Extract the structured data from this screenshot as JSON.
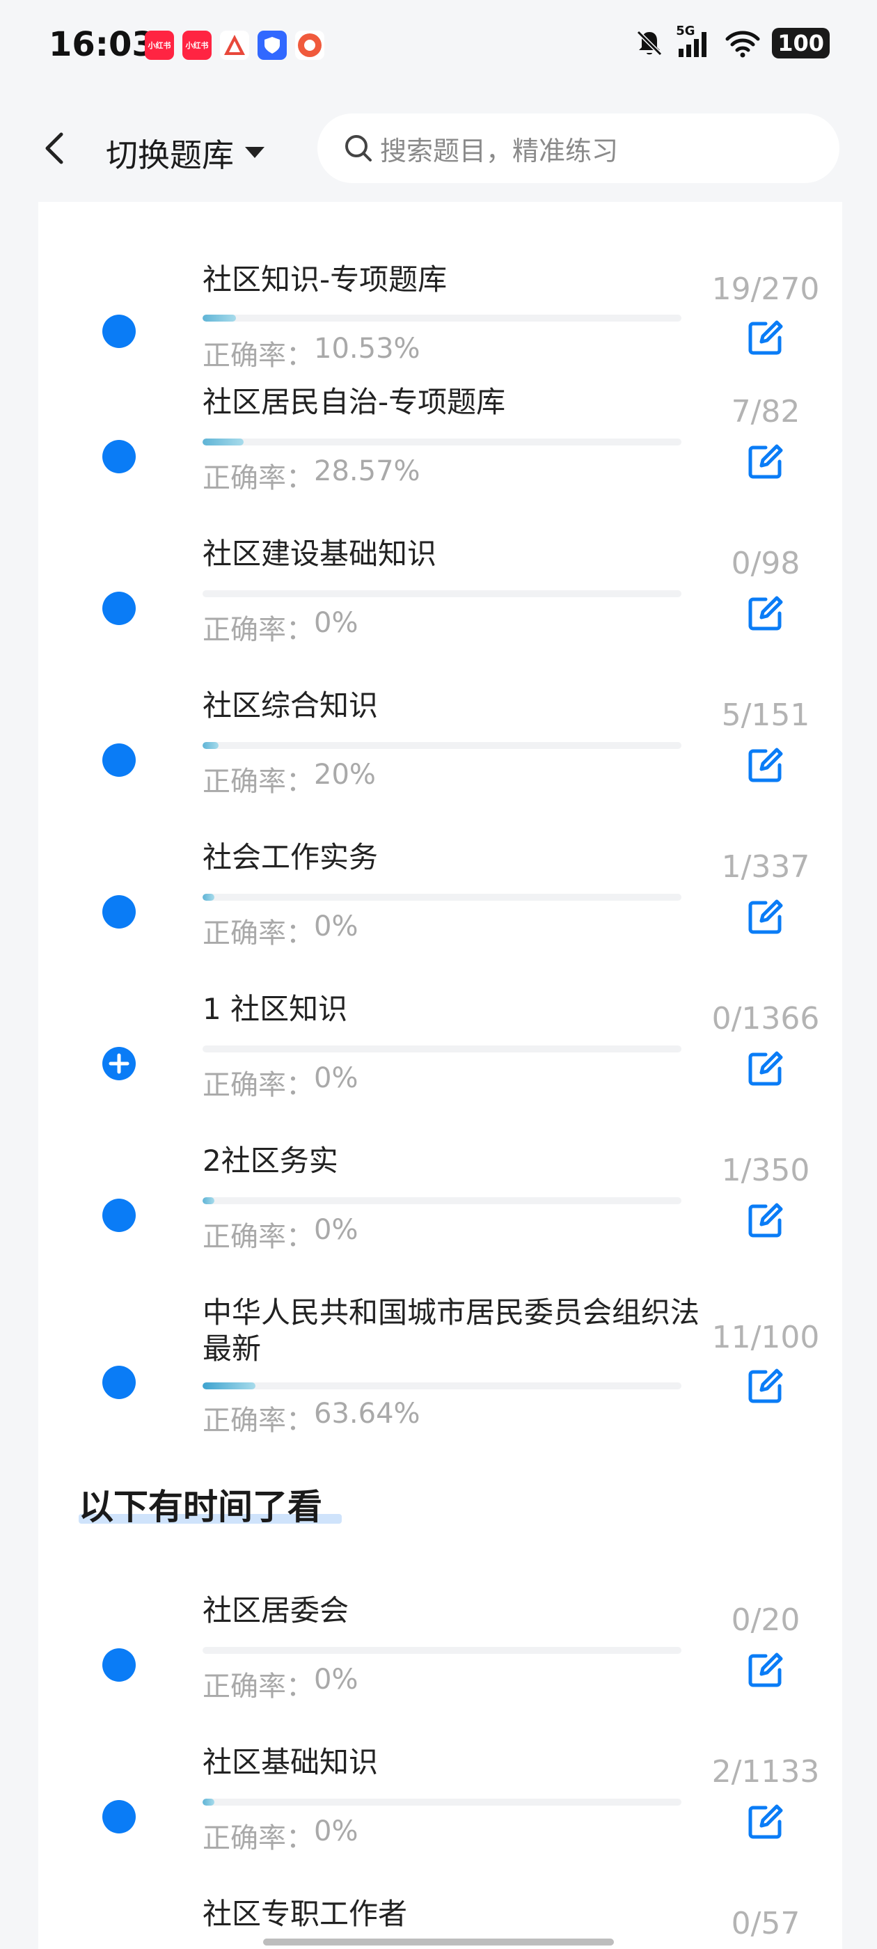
{
  "status_bar": {
    "time": "16:03",
    "apps": [
      {
        "name": "xiaohongshu-app-icon",
        "label": "小红书",
        "color": "#ff2442"
      },
      {
        "name": "xiaohongshu-app-icon-2",
        "label": "小红书",
        "color": "#ff2442"
      },
      {
        "name": "triangle-app-icon",
        "label": "",
        "color": "#e8483b"
      },
      {
        "name": "blue-shield-app-icon",
        "label": "",
        "color": "#3168ff"
      },
      {
        "name": "red-round-app-icon",
        "label": "",
        "color": "#f05a3c"
      }
    ],
    "network": "5G",
    "battery": "100"
  },
  "header": {
    "title": "切换题库",
    "search_placeholder": "搜索题目，精准练习"
  },
  "colors": {
    "accent": "#0a7cf6",
    "progress": "#5fb4d6",
    "muted_text": "#a9a9a9"
  },
  "labels": {
    "accuracy_prefix": "正确率："
  },
  "items": [
    {
      "title": "社区知识-专项题库",
      "progress": 0.0704,
      "accuracy": "10.53%",
      "count": "19/270",
      "icon": "dot"
    },
    {
      "title": "社区居民自治-专项题库",
      "progress": 0.0854,
      "accuracy": "28.57%",
      "count": "7/82",
      "icon": "dot"
    },
    {
      "title": "社区建设基础知识",
      "progress": 0.0,
      "accuracy": "0%",
      "count": "0/98",
      "icon": "dot"
    },
    {
      "title": "社区综合知识",
      "progress": 0.0331,
      "accuracy": "20%",
      "count": "5/151",
      "icon": "dot"
    },
    {
      "title": "社会工作实务",
      "progress": 0.003,
      "accuracy": "0%",
      "count": "1/337",
      "icon": "dot"
    },
    {
      "title": "1 社区知识",
      "progress": 0.0,
      "accuracy": "0%",
      "count": "0/1366",
      "icon": "plus"
    },
    {
      "title": "2社区务实",
      "progress": 0.0029,
      "accuracy": "0%",
      "count": "1/350",
      "icon": "dot"
    },
    {
      "title": "中华人民共和国城市居民委员会组织法 最新",
      "progress": 0.11,
      "accuracy": "63.64%",
      "count": "11/100",
      "icon": "dot"
    }
  ],
  "section_heading": "以下有时间了看",
  "later_items": [
    {
      "title": "社区居委会",
      "progress": 0.0,
      "accuracy": "0%",
      "count": "0/20",
      "icon": "dot"
    },
    {
      "title": "社区基础知识",
      "progress": 0.0018,
      "accuracy": "0%",
      "count": "2/1133",
      "icon": "dot"
    },
    {
      "title": "社区专职工作者",
      "progress": 0.0,
      "accuracy": "",
      "count": "0/57",
      "icon": "dot"
    }
  ]
}
